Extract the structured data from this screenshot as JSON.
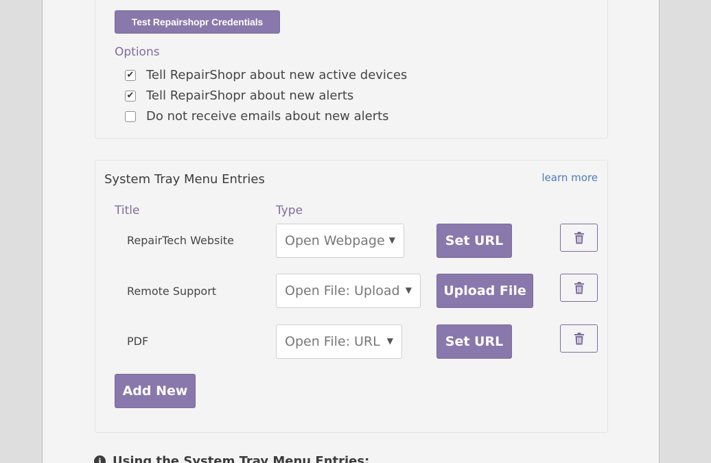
{
  "credentials": {
    "test_button": "Test Repairshopr Credentials"
  },
  "options": {
    "label": "Options",
    "items": [
      {
        "label": "Tell RepairShopr about new active devices",
        "checked": true
      },
      {
        "label": "Tell RepairShopr about new alerts",
        "checked": true
      },
      {
        "label": "Do not receive emails about new alerts",
        "checked": false
      }
    ]
  },
  "tray": {
    "title": "System Tray Menu Entries",
    "learn_more": "learn more",
    "col_title": "Title",
    "col_type": "Type",
    "entries": [
      {
        "title": "RepairTech Website",
        "type": "Open Webpage",
        "action": "Set URL"
      },
      {
        "title": "Remote Support",
        "type": "Open File: Upload",
        "action": "Upload File"
      },
      {
        "title": "PDF",
        "type": "Open File: URL",
        "action": "Set URL"
      }
    ],
    "add_button": "Add New"
  },
  "footer": {
    "heading": "Using the System Tray Menu Entries:"
  },
  "colors": {
    "accent": "#8878ab",
    "label": "#7d6b9e",
    "link": "#4a7ab8"
  }
}
